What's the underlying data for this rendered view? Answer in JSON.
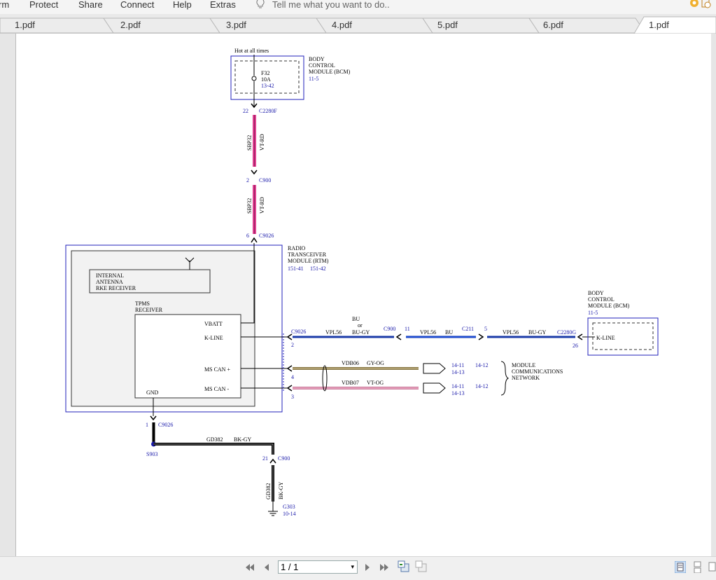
{
  "menu": {
    "items": [
      "rm",
      "Protect",
      "Share",
      "Connect",
      "Help",
      "Extras"
    ],
    "tell_me": "Tell me what you want to do.."
  },
  "tabs": [
    "1.pdf",
    "2.pdf",
    "3.pdf",
    "4.pdf",
    "5.pdf",
    "6.pdf",
    "1.pdf"
  ],
  "pager": {
    "value": "1 / 1"
  },
  "diagram": {
    "hot_label": "Hot at all times",
    "bcm_top": {
      "line1": "BODY",
      "line2": "CONTROL",
      "line3": "MODULE (BCM)",
      "ref": "11-5"
    },
    "fuse": {
      "name": "F32",
      "rating": "10A",
      "ref": "13-42"
    },
    "c2280f": {
      "pin": "22",
      "name": "C2280F"
    },
    "wire1": {
      "circuit": "SBP32",
      "color": "VT-RD"
    },
    "c900_top": {
      "pin": "2",
      "name": "C900"
    },
    "wire2": {
      "circuit": "SBP32",
      "color": "VT-RD"
    },
    "c9026_top": {
      "pin": "6",
      "name": "C9026"
    },
    "rtm": {
      "line1": "RADIO",
      "line2": "TRANSCEIVER",
      "line3": "MODULE (RTM)",
      "ref1": "151-41",
      "ref2": "151-42"
    },
    "antenna": {
      "line1": "INTERNAL",
      "line2": "ANTENNA",
      "line3": "RKE RECEIVER"
    },
    "tpms": {
      "line1": "TPMS",
      "line2": "RECEIVER",
      "vbatt": "VBATT",
      "kline": "K-LINE",
      "mscan_plus": "MS CAN +",
      "mscan_minus": "MS CAN -",
      "gnd": "GND"
    },
    "kline_wire": {
      "c9026": "C9026",
      "c9026_pin": "2",
      "circuit1": "VPL56",
      "color1_a": "BU",
      "color1_b": "or",
      "color1_c": "BU-GY",
      "c900": "C900",
      "c900_pin": "11",
      "circuit2": "VPL56",
      "color2": "BU",
      "c211": "C211",
      "c211_pin": "5",
      "circuit3": "VPL56",
      "color3": "BU-GY",
      "c2280g": "C2280G",
      "c2280g_pin": "26"
    },
    "bcm_right": {
      "line1": "BODY",
      "line2": "CONTROL",
      "line3": "MODULE (BCM)",
      "ref": "11-5",
      "kline": "K-LINE"
    },
    "can_plus": {
      "pin": "4",
      "circuit": "VDB06",
      "color": "GY-OG",
      "ref1": "14-11",
      "ref2": "14-13",
      "ref3": "14-12"
    },
    "can_minus": {
      "pin": "3",
      "circuit": "VDB07",
      "color": "VT-OG",
      "ref1": "14-11",
      "ref2": "14-13",
      "ref3": "14-12"
    },
    "network": {
      "line1": "MODULE",
      "line2": "COMMUNICATIONS",
      "line3": "NETWORK"
    },
    "gnd_wire": {
      "c9026_pin": "1",
      "c9026": "C9026",
      "splice": "S903",
      "circuit": "GD382",
      "color": "BK-GY",
      "c900_pin": "21",
      "c900": "C900",
      "v_circuit": "GD382",
      "v_color": "BK-GY",
      "ground": "G303",
      "ground_ref": "10-14"
    }
  }
}
